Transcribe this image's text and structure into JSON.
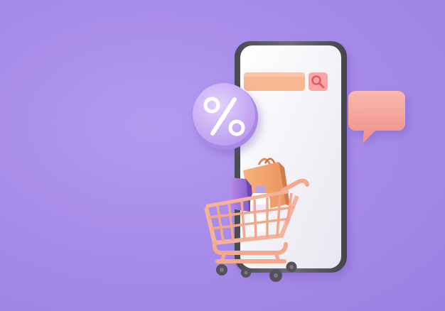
{
  "scene": {
    "background_color": "#a88ce9",
    "phone": {
      "frame_color": "#5b5a63",
      "screen_color": "#f5f4f8"
    },
    "search_bar": {
      "field_color": "#f6b792",
      "button_color": "#f7a7a5",
      "icon": "search-icon"
    },
    "discount_badge": {
      "symbol": "%",
      "color": "#cfb6f6"
    },
    "chat_bubble": {
      "color": "#f6a7a0",
      "icon": "speech-bubble-icon"
    },
    "cart": {
      "color": "#f6b79f",
      "wheel_color": "#55515c",
      "icon": "shopping-cart-icon"
    },
    "items": [
      "shopping-bag-orange",
      "shopping-bag-purple",
      "milk-bottle"
    ]
  }
}
